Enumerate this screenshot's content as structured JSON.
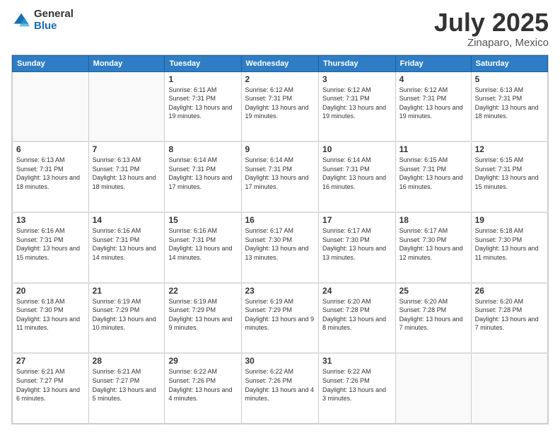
{
  "logo": {
    "general": "General",
    "blue": "Blue"
  },
  "title": {
    "month": "July 2025",
    "location": "Zinaparo, Mexico"
  },
  "weekdays": [
    "Sunday",
    "Monday",
    "Tuesday",
    "Wednesday",
    "Thursday",
    "Friday",
    "Saturday"
  ],
  "weeks": [
    [
      {
        "day": "",
        "info": ""
      },
      {
        "day": "",
        "info": ""
      },
      {
        "day": "1",
        "info": "Sunrise: 6:11 AM\nSunset: 7:31 PM\nDaylight: 13 hours and 19 minutes."
      },
      {
        "day": "2",
        "info": "Sunrise: 6:12 AM\nSunset: 7:31 PM\nDaylight: 13 hours and 19 minutes."
      },
      {
        "day": "3",
        "info": "Sunrise: 6:12 AM\nSunset: 7:31 PM\nDaylight: 13 hours and 19 minutes."
      },
      {
        "day": "4",
        "info": "Sunrise: 6:12 AM\nSunset: 7:31 PM\nDaylight: 13 hours and 19 minutes."
      },
      {
        "day": "5",
        "info": "Sunrise: 6:13 AM\nSunset: 7:31 PM\nDaylight: 13 hours and 18 minutes."
      }
    ],
    [
      {
        "day": "6",
        "info": "Sunrise: 6:13 AM\nSunset: 7:31 PM\nDaylight: 13 hours and 18 minutes."
      },
      {
        "day": "7",
        "info": "Sunrise: 6:13 AM\nSunset: 7:31 PM\nDaylight: 13 hours and 18 minutes."
      },
      {
        "day": "8",
        "info": "Sunrise: 6:14 AM\nSunset: 7:31 PM\nDaylight: 13 hours and 17 minutes."
      },
      {
        "day": "9",
        "info": "Sunrise: 6:14 AM\nSunset: 7:31 PM\nDaylight: 13 hours and 17 minutes."
      },
      {
        "day": "10",
        "info": "Sunrise: 6:14 AM\nSunset: 7:31 PM\nDaylight: 13 hours and 16 minutes."
      },
      {
        "day": "11",
        "info": "Sunrise: 6:15 AM\nSunset: 7:31 PM\nDaylight: 13 hours and 16 minutes."
      },
      {
        "day": "12",
        "info": "Sunrise: 6:15 AM\nSunset: 7:31 PM\nDaylight: 13 hours and 15 minutes."
      }
    ],
    [
      {
        "day": "13",
        "info": "Sunrise: 6:16 AM\nSunset: 7:31 PM\nDaylight: 13 hours and 15 minutes."
      },
      {
        "day": "14",
        "info": "Sunrise: 6:16 AM\nSunset: 7:31 PM\nDaylight: 13 hours and 14 minutes."
      },
      {
        "day": "15",
        "info": "Sunrise: 6:16 AM\nSunset: 7:31 PM\nDaylight: 13 hours and 14 minutes."
      },
      {
        "day": "16",
        "info": "Sunrise: 6:17 AM\nSunset: 7:30 PM\nDaylight: 13 hours and 13 minutes."
      },
      {
        "day": "17",
        "info": "Sunrise: 6:17 AM\nSunset: 7:30 PM\nDaylight: 13 hours and 13 minutes."
      },
      {
        "day": "18",
        "info": "Sunrise: 6:17 AM\nSunset: 7:30 PM\nDaylight: 13 hours and 12 minutes."
      },
      {
        "day": "19",
        "info": "Sunrise: 6:18 AM\nSunset: 7:30 PM\nDaylight: 13 hours and 11 minutes."
      }
    ],
    [
      {
        "day": "20",
        "info": "Sunrise: 6:18 AM\nSunset: 7:30 PM\nDaylight: 13 hours and 11 minutes."
      },
      {
        "day": "21",
        "info": "Sunrise: 6:19 AM\nSunset: 7:29 PM\nDaylight: 13 hours and 10 minutes."
      },
      {
        "day": "22",
        "info": "Sunrise: 6:19 AM\nSunset: 7:29 PM\nDaylight: 13 hours and 9 minutes."
      },
      {
        "day": "23",
        "info": "Sunrise: 6:19 AM\nSunset: 7:29 PM\nDaylight: 13 hours and 9 minutes."
      },
      {
        "day": "24",
        "info": "Sunrise: 6:20 AM\nSunset: 7:28 PM\nDaylight: 13 hours and 8 minutes."
      },
      {
        "day": "25",
        "info": "Sunrise: 6:20 AM\nSunset: 7:28 PM\nDaylight: 13 hours and 7 minutes."
      },
      {
        "day": "26",
        "info": "Sunrise: 6:20 AM\nSunset: 7:28 PM\nDaylight: 13 hours and 7 minutes."
      }
    ],
    [
      {
        "day": "27",
        "info": "Sunrise: 6:21 AM\nSunset: 7:27 PM\nDaylight: 13 hours and 6 minutes."
      },
      {
        "day": "28",
        "info": "Sunrise: 6:21 AM\nSunset: 7:27 PM\nDaylight: 13 hours and 5 minutes."
      },
      {
        "day": "29",
        "info": "Sunrise: 6:22 AM\nSunset: 7:26 PM\nDaylight: 13 hours and 4 minutes."
      },
      {
        "day": "30",
        "info": "Sunrise: 6:22 AM\nSunset: 7:26 PM\nDaylight: 13 hours and 4 minutes."
      },
      {
        "day": "31",
        "info": "Sunrise: 6:22 AM\nSunset: 7:26 PM\nDaylight: 13 hours and 3 minutes."
      },
      {
        "day": "",
        "info": ""
      },
      {
        "day": "",
        "info": ""
      }
    ]
  ]
}
